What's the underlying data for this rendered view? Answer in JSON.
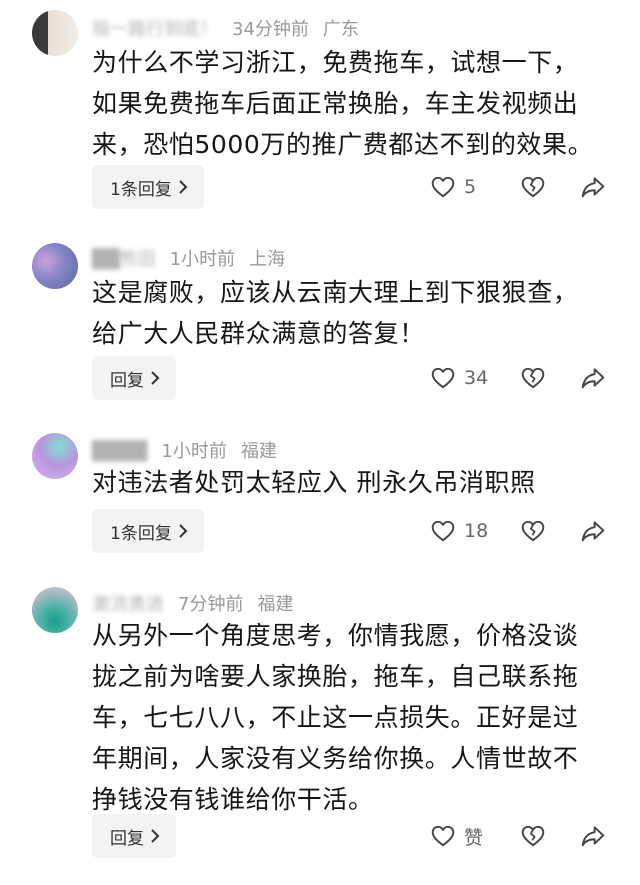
{
  "comments": [
    {
      "user": "指一路行到底！",
      "time": "34分钟前",
      "location": "广东",
      "lines": [
        "为什么不学习浙江，免费拖车，试想一下，",
        "如果免费拖车后面正常换胎，车主发视频出",
        "来，恐怕5000万的推广费都达不到的效果。"
      ],
      "reply_label": "1条回复",
      "like_count": "5"
    },
    {
      "user": "██熊田",
      "time": "1小时前",
      "location": "上海",
      "lines": [
        "这是腐败，应该从云南大理上到下狠狠查，",
        "给广大人民群众满意的答复！"
      ],
      "reply_label": "回复",
      "like_count": "34"
    },
    {
      "user": "████",
      "time": "1小时前",
      "location": "福建",
      "lines": [
        "对违法者处罚太轻应入 刑永久吊消职照"
      ],
      "reply_label": "1条回复",
      "like_count": "18"
    },
    {
      "user": "激流勇进",
      "time": "7分钟前",
      "location": "福建",
      "lines": [
        "从另外一个角度思考，你情我愿，价格没谈",
        "拢之前为啥要人家换胎，拖车，自己联系拖",
        "车，七七八八，不止这一点损失。正好是过",
        "年期间，人家没有义务给你换。人情世故不",
        "挣钱没有钱谁给你干活。"
      ],
      "reply_label": "回复",
      "like_count": "赞"
    }
  ],
  "icons": {
    "like": "heart-outline-icon",
    "dislike": "broken-heart-icon",
    "share": "share-arrow-icon",
    "chevron": "chevron-right-icon"
  },
  "colors": {
    "meta": "#999999",
    "text": "#161616",
    "button_bg": "#f3f3f3"
  }
}
